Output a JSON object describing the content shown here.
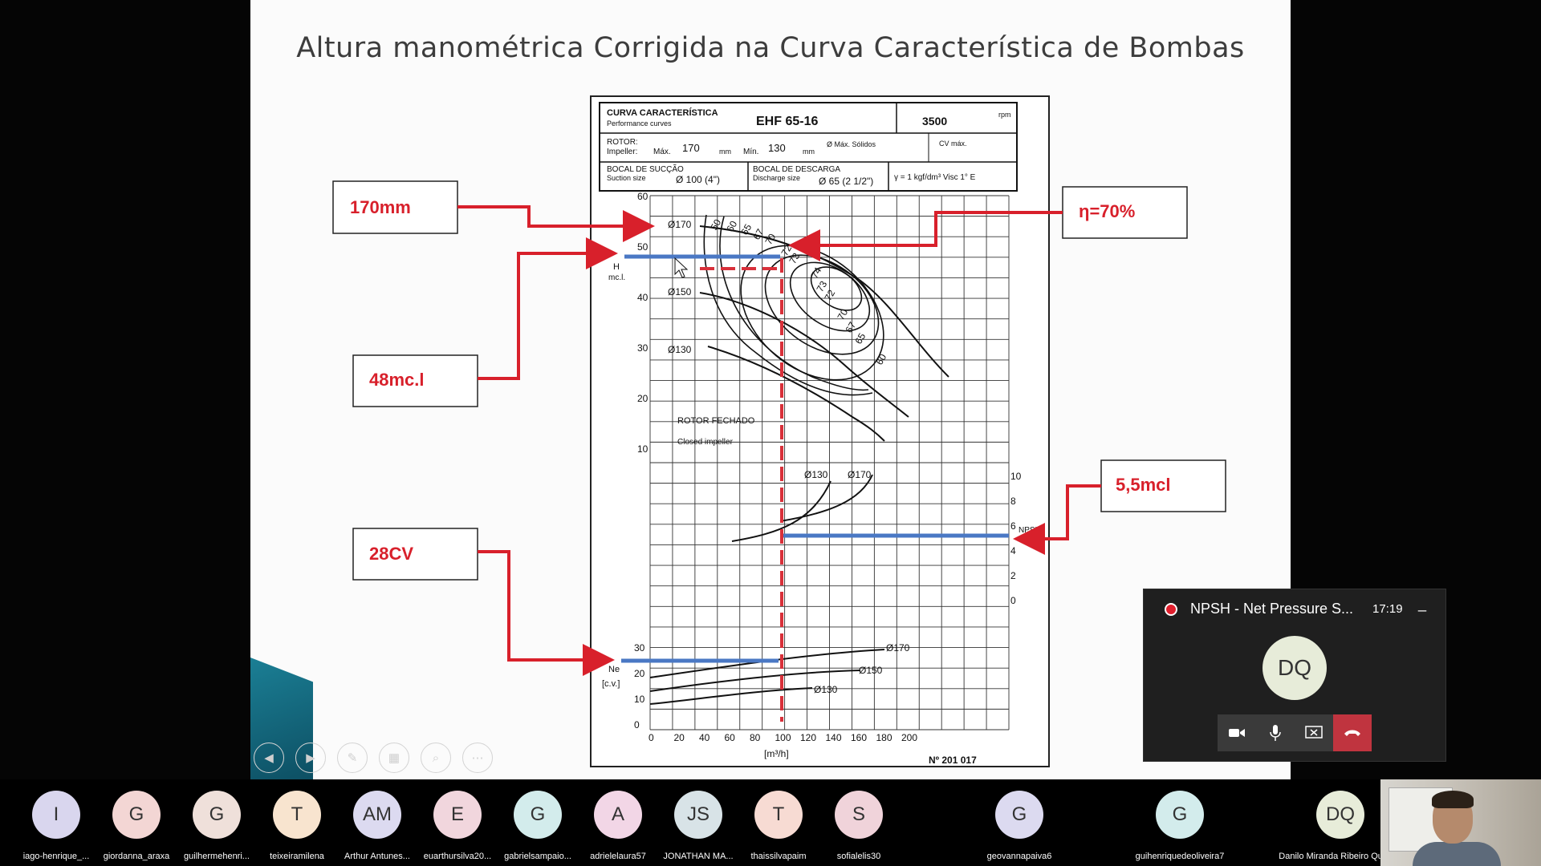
{
  "slide": {
    "title": "Altura manométrica Corrigida na Curva Característica de Bombas",
    "callouts": {
      "impeller": "170mm",
      "head": "48mc.l",
      "power": "28CV",
      "efficiency": "η=70%",
      "npsh": "5,5mcl"
    },
    "datasheet": {
      "curve_label": "CURVA CARACTERÍSTICA",
      "curve_label_en": "Performance curves",
      "model": "EHF 65-16",
      "rpm_value": "3500",
      "rpm_unit": "rpm",
      "rotor_label": "ROTOR:",
      "impeller_label": "Impeller:",
      "max_label": "Máx.",
      "max_value": "170",
      "min_label": "Mín.",
      "min_value": "130",
      "mm_unit": "mm",
      "solids_label": "Ø Máx. Sólidos",
      "cv_label": "CV máx.",
      "suction_label": "BOCAL DE SUCÇÃO",
      "suction_label_en": "Suction size",
      "suction_value": "Ø 100 (4\")",
      "discharge_label": "BOCAL DE DESCARGA",
      "discharge_label_en": "Discharge size",
      "discharge_value": "Ø 65 (2 1/2\")",
      "gamma_text": "γ = 1 kgf/dm³  Visc 1° E",
      "rotor_type": "ROTOR  FECHADO",
      "rotor_type_en": "Closed   impeller",
      "head_axis_label": "H",
      "head_axis_unit": "mc.l.",
      "npsh_axis_label": "NPSH",
      "npsh_axis_unit": "mc.l",
      "power_axis_label": "Ne",
      "power_axis_unit": "[c.v.]",
      "flow_axis_unit": "[m³/h]",
      "doc_number": "Nº  201  017",
      "head_ticks": [
        "60",
        "50",
        "40",
        "30",
        "20",
        "10"
      ],
      "npsh_ticks": [
        "10",
        "8",
        "6",
        "4",
        "2",
        "0"
      ],
      "power_ticks": [
        "30",
        "20",
        "10",
        "0"
      ],
      "flow_ticks": [
        "0",
        "20",
        "40",
        "60",
        "80",
        "100",
        "120",
        "140",
        "160",
        "180",
        "200"
      ],
      "head_curve_labels": [
        "Ø170",
        "Ø150",
        "Ø130"
      ],
      "efficiency_labels": [
        "50",
        "60",
        "65",
        "67",
        "70",
        "72",
        "73",
        "74",
        "73",
        "72",
        "70",
        "67",
        "65",
        "60"
      ],
      "npsh_curve_labels": [
        "Ø130",
        "Ø170"
      ],
      "power_curve_labels": [
        "Ø170",
        "Ø150",
        "Ø130"
      ]
    }
  },
  "call": {
    "title": "NPSH - Net Pressure S...",
    "time": "17:19",
    "minimize": "_",
    "avatar_initials": "DQ",
    "colors": {
      "record": "#e01f2d",
      "hangup": "#c0343f"
    },
    "icons": [
      "video-camera-icon",
      "microphone-icon",
      "share-screen-icon",
      "hang-up-icon"
    ]
  },
  "participants": [
    {
      "initials": "I",
      "name": "iago-henrique_...",
      "color": "#d9d6ee"
    },
    {
      "initials": "G",
      "name": "giordanna_araxa",
      "color": "#f3d6d4"
    },
    {
      "initials": "G",
      "name": "guilhermehenri...",
      "color": "#efe0da"
    },
    {
      "initials": "T",
      "name": "teixeiramilena",
      "color": "#f8e4cf"
    },
    {
      "initials": "AM",
      "name": "Arthur  Antunes...",
      "color": "#dcdaf0"
    },
    {
      "initials": "E",
      "name": "euarthursilva20...",
      "color": "#f1d6dd"
    },
    {
      "initials": "G",
      "name": "gabrielsampaio...",
      "color": "#d3ecec"
    },
    {
      "initials": "A",
      "name": "adrielelaura57",
      "color": "#f2d6e6"
    },
    {
      "initials": "JS",
      "name": "JONATHAN MA...",
      "color": "#d8e3e7"
    },
    {
      "initials": "T",
      "name": "thaissilvapaim",
      "color": "#f7dbd3"
    },
    {
      "initials": "S",
      "name": "sofialelis30",
      "color": "#f0d3da"
    },
    {
      "initials": "G",
      "name": "geovannapaiva6",
      "color": "#dcdaf0"
    },
    {
      "initials": "G",
      "name": "guihenriquedeoliveira7",
      "color": "#d3ecec"
    },
    {
      "initials": "DQ",
      "name": "Danilo Miranda Ribeiro Queiroz",
      "color": "#e7ecd9"
    }
  ]
}
